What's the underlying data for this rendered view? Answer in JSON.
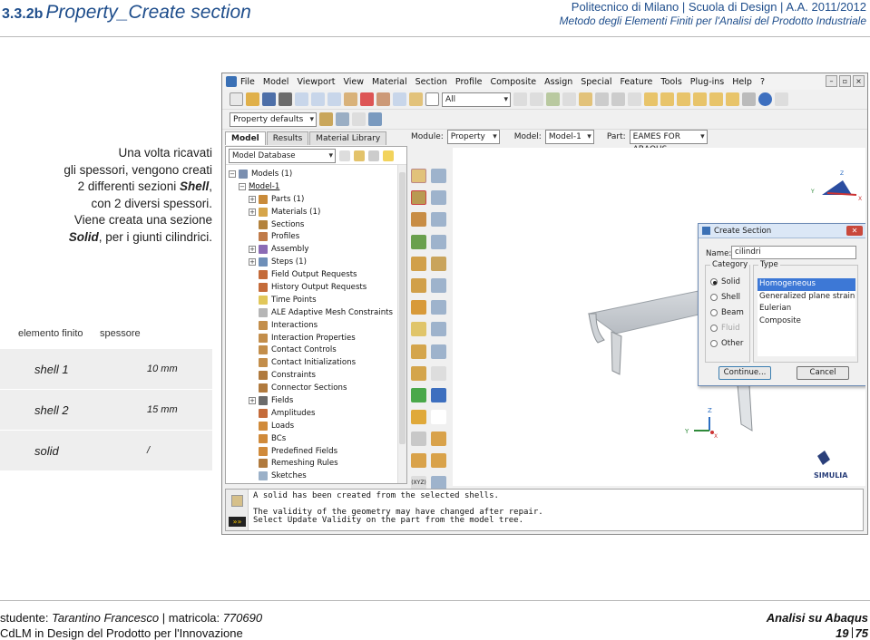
{
  "header": {
    "section_number": "3.3.2b",
    "section_title": "Property_Create section",
    "institution_line": "Politecnico di Milano | Scuola di Design | A.A. 2011/2012",
    "course_line": "Metodo degli Elementi Finiti per l'Analisi del Prodotto Industriale"
  },
  "intro": {
    "l1": "Una volta ricavati",
    "l2": "gli spessori, vengono creati",
    "l3a": "2 differenti sezioni ",
    "l3b": "Shell",
    "l3c": ",",
    "l4": "con 2 diversi spessori.",
    "l5": "Viene creata una sezione",
    "l6a": "Solid",
    "l6b": ", per i giunti cilindrici."
  },
  "table": {
    "col1": "elemento finito",
    "col2": "spessore",
    "rows": [
      {
        "element": "shell 1",
        "thickness": "10 mm"
      },
      {
        "element": "shell 2",
        "thickness": "15 mm"
      },
      {
        "element": "solid",
        "thickness": "/"
      }
    ]
  },
  "abaqus": {
    "menu": [
      "File",
      "Model",
      "Viewport",
      "View",
      "Material",
      "Section",
      "Profile",
      "Composite",
      "Assign",
      "Special",
      "Feature",
      "Tools",
      "Plug-ins",
      "Help",
      "?"
    ],
    "selection_filter": "All",
    "property_defaults": "Property defaults",
    "tabs": [
      "Model",
      "Results",
      "Material Library"
    ],
    "tree_combo": "Model Database",
    "context": {
      "module_label": "Module:",
      "module_value": "Property",
      "model_label": "Model:",
      "model_value": "Model-1",
      "part_label": "Part:",
      "part_value": "EAMES FOR ABAQUS"
    },
    "tree": [
      "Models (1)",
      "Model-1",
      "Parts (1)",
      "Materials (1)",
      "Sections",
      "Profiles",
      "Assembly",
      "Steps (1)",
      "Field Output Requests",
      "History Output Requests",
      "Time Points",
      "ALE Adaptive Mesh Constraints",
      "Interactions",
      "Interaction Properties",
      "Contact Controls",
      "Contact Initializations",
      "Constraints",
      "Connector Sections",
      "Fields",
      "Amplitudes",
      "Loads",
      "BCs",
      "Predefined Fields",
      "Remeshing Rules",
      "Sketches"
    ],
    "dialog": {
      "title": "Create Section",
      "name_label": "Name:",
      "name_value": "cilindri",
      "category_label": "Category",
      "type_label": "Type",
      "categories": [
        "Solid",
        "Shell",
        "Beam",
        "Fluid",
        "Other"
      ],
      "types": [
        "Homogeneous",
        "Generalized plane strain",
        "Eulerian",
        "Composite"
      ],
      "continue": "Continue...",
      "cancel": "Cancel"
    },
    "messages": {
      "m1": "A solid has been created from the selected shells.",
      "m2": "The validity of the geometry may have changed after repair.",
      "m3": "Select Update Validity on the part from the model tree."
    },
    "brand": "SIMULIA",
    "triad_labels": {
      "y": "Y",
      "z": "Z",
      "x": "X",
      "triad": "(XYZ)"
    }
  },
  "footer": {
    "student_label": "studente: ",
    "student_name": "Tarantino Francesco",
    "matricola_label": " | matricola: ",
    "matricola": "770690",
    "degree": "CdLM in Design del Prodotto per l'Innovazione",
    "course_short": "Analisi su Abaqus",
    "page": "19",
    "page_total": "75"
  },
  "colors": {
    "accent": "#1f4e8c",
    "selection": "#3d78d6"
  }
}
